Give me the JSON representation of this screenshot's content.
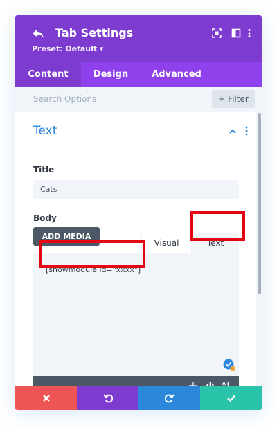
{
  "header": {
    "title": "Tab Settings",
    "preset": "Preset: Default ▾",
    "icons": [
      "back-arrow-icon",
      "focus-icon",
      "split-view-icon",
      "more-vertical-icon"
    ]
  },
  "tabs": [
    {
      "label": "Content",
      "active": true
    },
    {
      "label": "Design",
      "active": false
    },
    {
      "label": "Advanced",
      "active": false
    }
  ],
  "search": {
    "placeholder": "Search Options",
    "filter_label": "+ Filter"
  },
  "section": {
    "title": "Text"
  },
  "fields": {
    "title_label": "Title",
    "title_value": "Cats",
    "body_label": "Body"
  },
  "editor": {
    "add_media_label": "ADD MEDIA",
    "visual_tab": "Visual",
    "text_tab": "Text",
    "content": "[showmodule id=\"xxxx\"]",
    "toolbar_icons": [
      "plus-icon",
      "power-icon",
      "sort-arrows-icon"
    ]
  },
  "footer": {
    "buttons": [
      {
        "name": "discard",
        "icon": "x-icon",
        "color": "#ef5555"
      },
      {
        "name": "undo",
        "icon": "undo-icon",
        "color": "#7e3bd0"
      },
      {
        "name": "redo",
        "icon": "redo-icon",
        "color": "#2b87da"
      },
      {
        "name": "save",
        "icon": "check-icon",
        "color": "#29c4a9"
      }
    ]
  },
  "colors": {
    "header": "#7e3bd0",
    "tabs": "#8f42ec",
    "accent": "#2b87da",
    "highlight": "#e30613"
  }
}
